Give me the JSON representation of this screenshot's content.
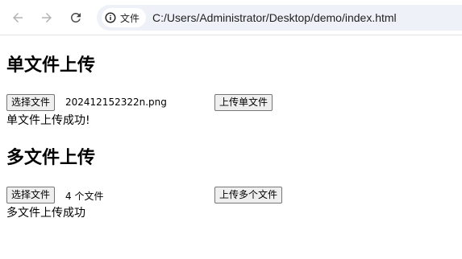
{
  "browser": {
    "site_info_label": "文件",
    "url": "C:/Users/Administrator/Desktop/demo/index.html"
  },
  "single_upload": {
    "heading": "单文件上传",
    "choose_button": "选择文件",
    "file_status": "202412152322n.png",
    "upload_button": "上传单文件",
    "result_message": "单文件上传成功!"
  },
  "multi_upload": {
    "heading": "多文件上传",
    "choose_button": "选择文件",
    "file_status": "4 个文件",
    "upload_button": "上传多个文件",
    "result_message": "多文件上传成功"
  }
}
